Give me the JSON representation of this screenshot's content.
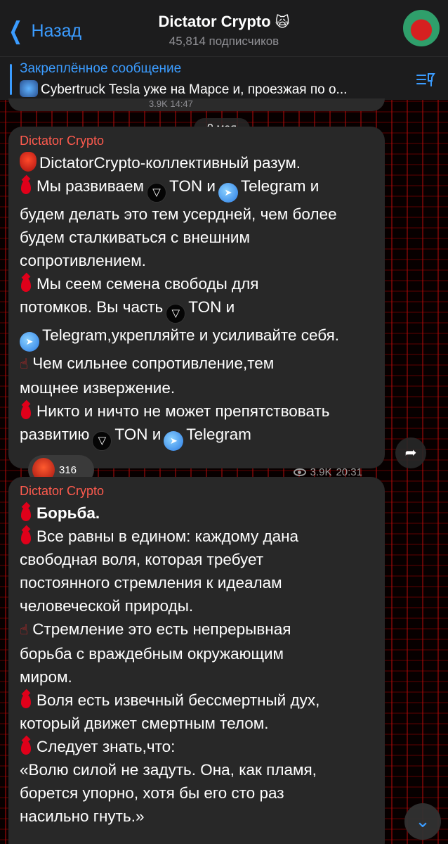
{
  "header": {
    "back_label": "Назад",
    "title": "Dictator Crypto",
    "title_emoji": "🙀",
    "subscribers": "45,814 подписчиков"
  },
  "pinned": {
    "label": "Закреплённое сообщение",
    "text": "Cybertruck  Tesla уже на Марсе и, проезжая по о..."
  },
  "previous_message": {
    "meta": "3.9K 14:47"
  },
  "date_divider": "9 мая",
  "messages": [
    {
      "author": "Dictator Crypto",
      "lines": {
        "l1": "DictatorCrypto-коллективный разум.",
        "l2a": "Мы развиваем",
        "l2b": "TON и",
        "l2c": "Telegram и",
        "l3": "будем делать это тем усердней, чем более",
        "l4": "будем сталкиваться с внешним",
        "l5": "сопротивлением.",
        "l6": "Мы сеем семена свободы для",
        "l7a": "потомков. Вы часть",
        "l7b": "TON и",
        "l8": "Telegram,укрепляйте и усиливайте себя.",
        "l9": "Чем сильнее сопротивление,тем",
        "l10": "мощнее извержение.",
        "l11": "Никто и ничто не может препятствовать",
        "l12a": "развитию",
        "l12b": "TON и",
        "l12c": "Telegram"
      },
      "reaction_count": "316",
      "views": "3.9K",
      "time": "20:31"
    },
    {
      "author": "Dictator Crypto",
      "lines": {
        "l1": "Борьба.",
        "l2": "Все равны в едином: каждому дана",
        "l3": "свободная воля, которая требует",
        "l4": "постоянного стремления к идеалам",
        "l5": "человеческой природы.",
        "l6": "Стремление это есть непрерывная",
        "l7": "борьба с враждебным окружающим",
        "l8": "миром.",
        "l9": "Воля есть извечный бессмертный дух,",
        "l10": "который движет смертным телом.",
        "l11": "Следует знать,что:",
        "l12": "«Волю силой не задуть. Она, как пламя,",
        "l13": "борется упорно, хотя бы его сто раз",
        "l14": "насильно гнуть.»"
      }
    }
  ],
  "icons": {
    "back": "chevron-left-icon",
    "pin_list": "pinned-list-icon",
    "share": "share-arrow-icon",
    "scroll_down": "chevron-down-icon"
  },
  "colors": {
    "accent": "#3b9cff",
    "author": "#ff5b4e",
    "bubble": "#282828",
    "header": "#1c1c1d"
  }
}
